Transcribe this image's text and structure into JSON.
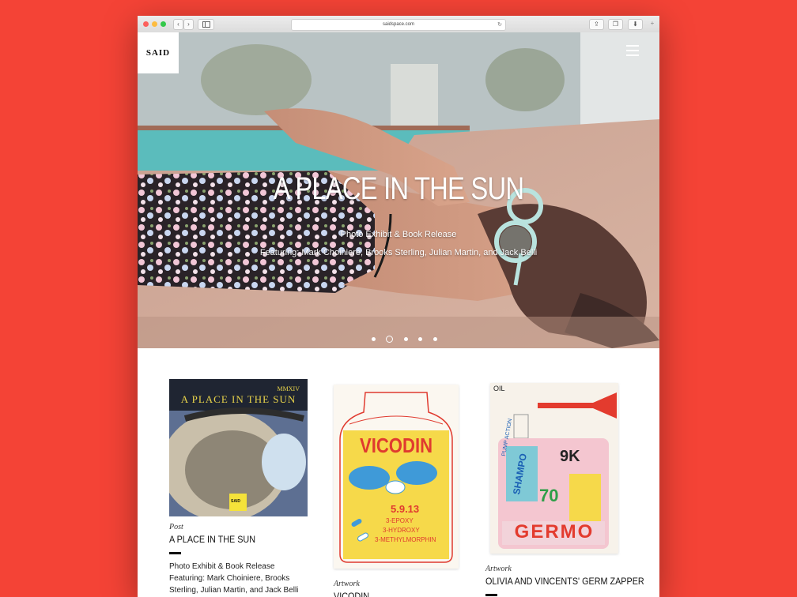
{
  "browser": {
    "url": "saidspace.com",
    "buttons": {
      "back": "‹",
      "forward": "›",
      "share": "⇪",
      "tabs": "❐",
      "download": "⬇",
      "new_tab": "+"
    }
  },
  "site": {
    "logo": "SAID"
  },
  "hero": {
    "title": "A PLACE IN THE SUN",
    "subtitle": "Photo Exhibit & Book Release",
    "featuring": "Featuring: Mark Choiniere, Brooks Sterling, Julian Martin, and Jack Belli",
    "slides": 5,
    "active_slide": 2
  },
  "cards": [
    {
      "type": "Post",
      "title": "A PLACE IN THE SUN",
      "cover_title": "A PLACE IN THE SUN",
      "cover_year": "MMXIV",
      "cover_badge": "SAID",
      "text": "Photo Exhibit & Book Release Featuring: Mark Choiniere, Brooks Sterling, Julian Martin, and Jack Belli"
    },
    {
      "type": "Artwork",
      "title": "VICODIN",
      "poster_title": "VICODIN",
      "poster_lines": [
        "5.9.13",
        "3-EPOXY",
        "3-HYDROXY",
        "3-METHYLMORPHIN"
      ]
    },
    {
      "type": "Artwork",
      "title": "OLIVIA AND VINCENTS' GERM ZAPPER",
      "poster_title": "GERMO",
      "poster_lines": [
        "OIL",
        "PUMP ACTION",
        "SHAMPO",
        "9K",
        "70"
      ]
    }
  ],
  "colors": {
    "background": "#f44336",
    "text": "#111111"
  }
}
